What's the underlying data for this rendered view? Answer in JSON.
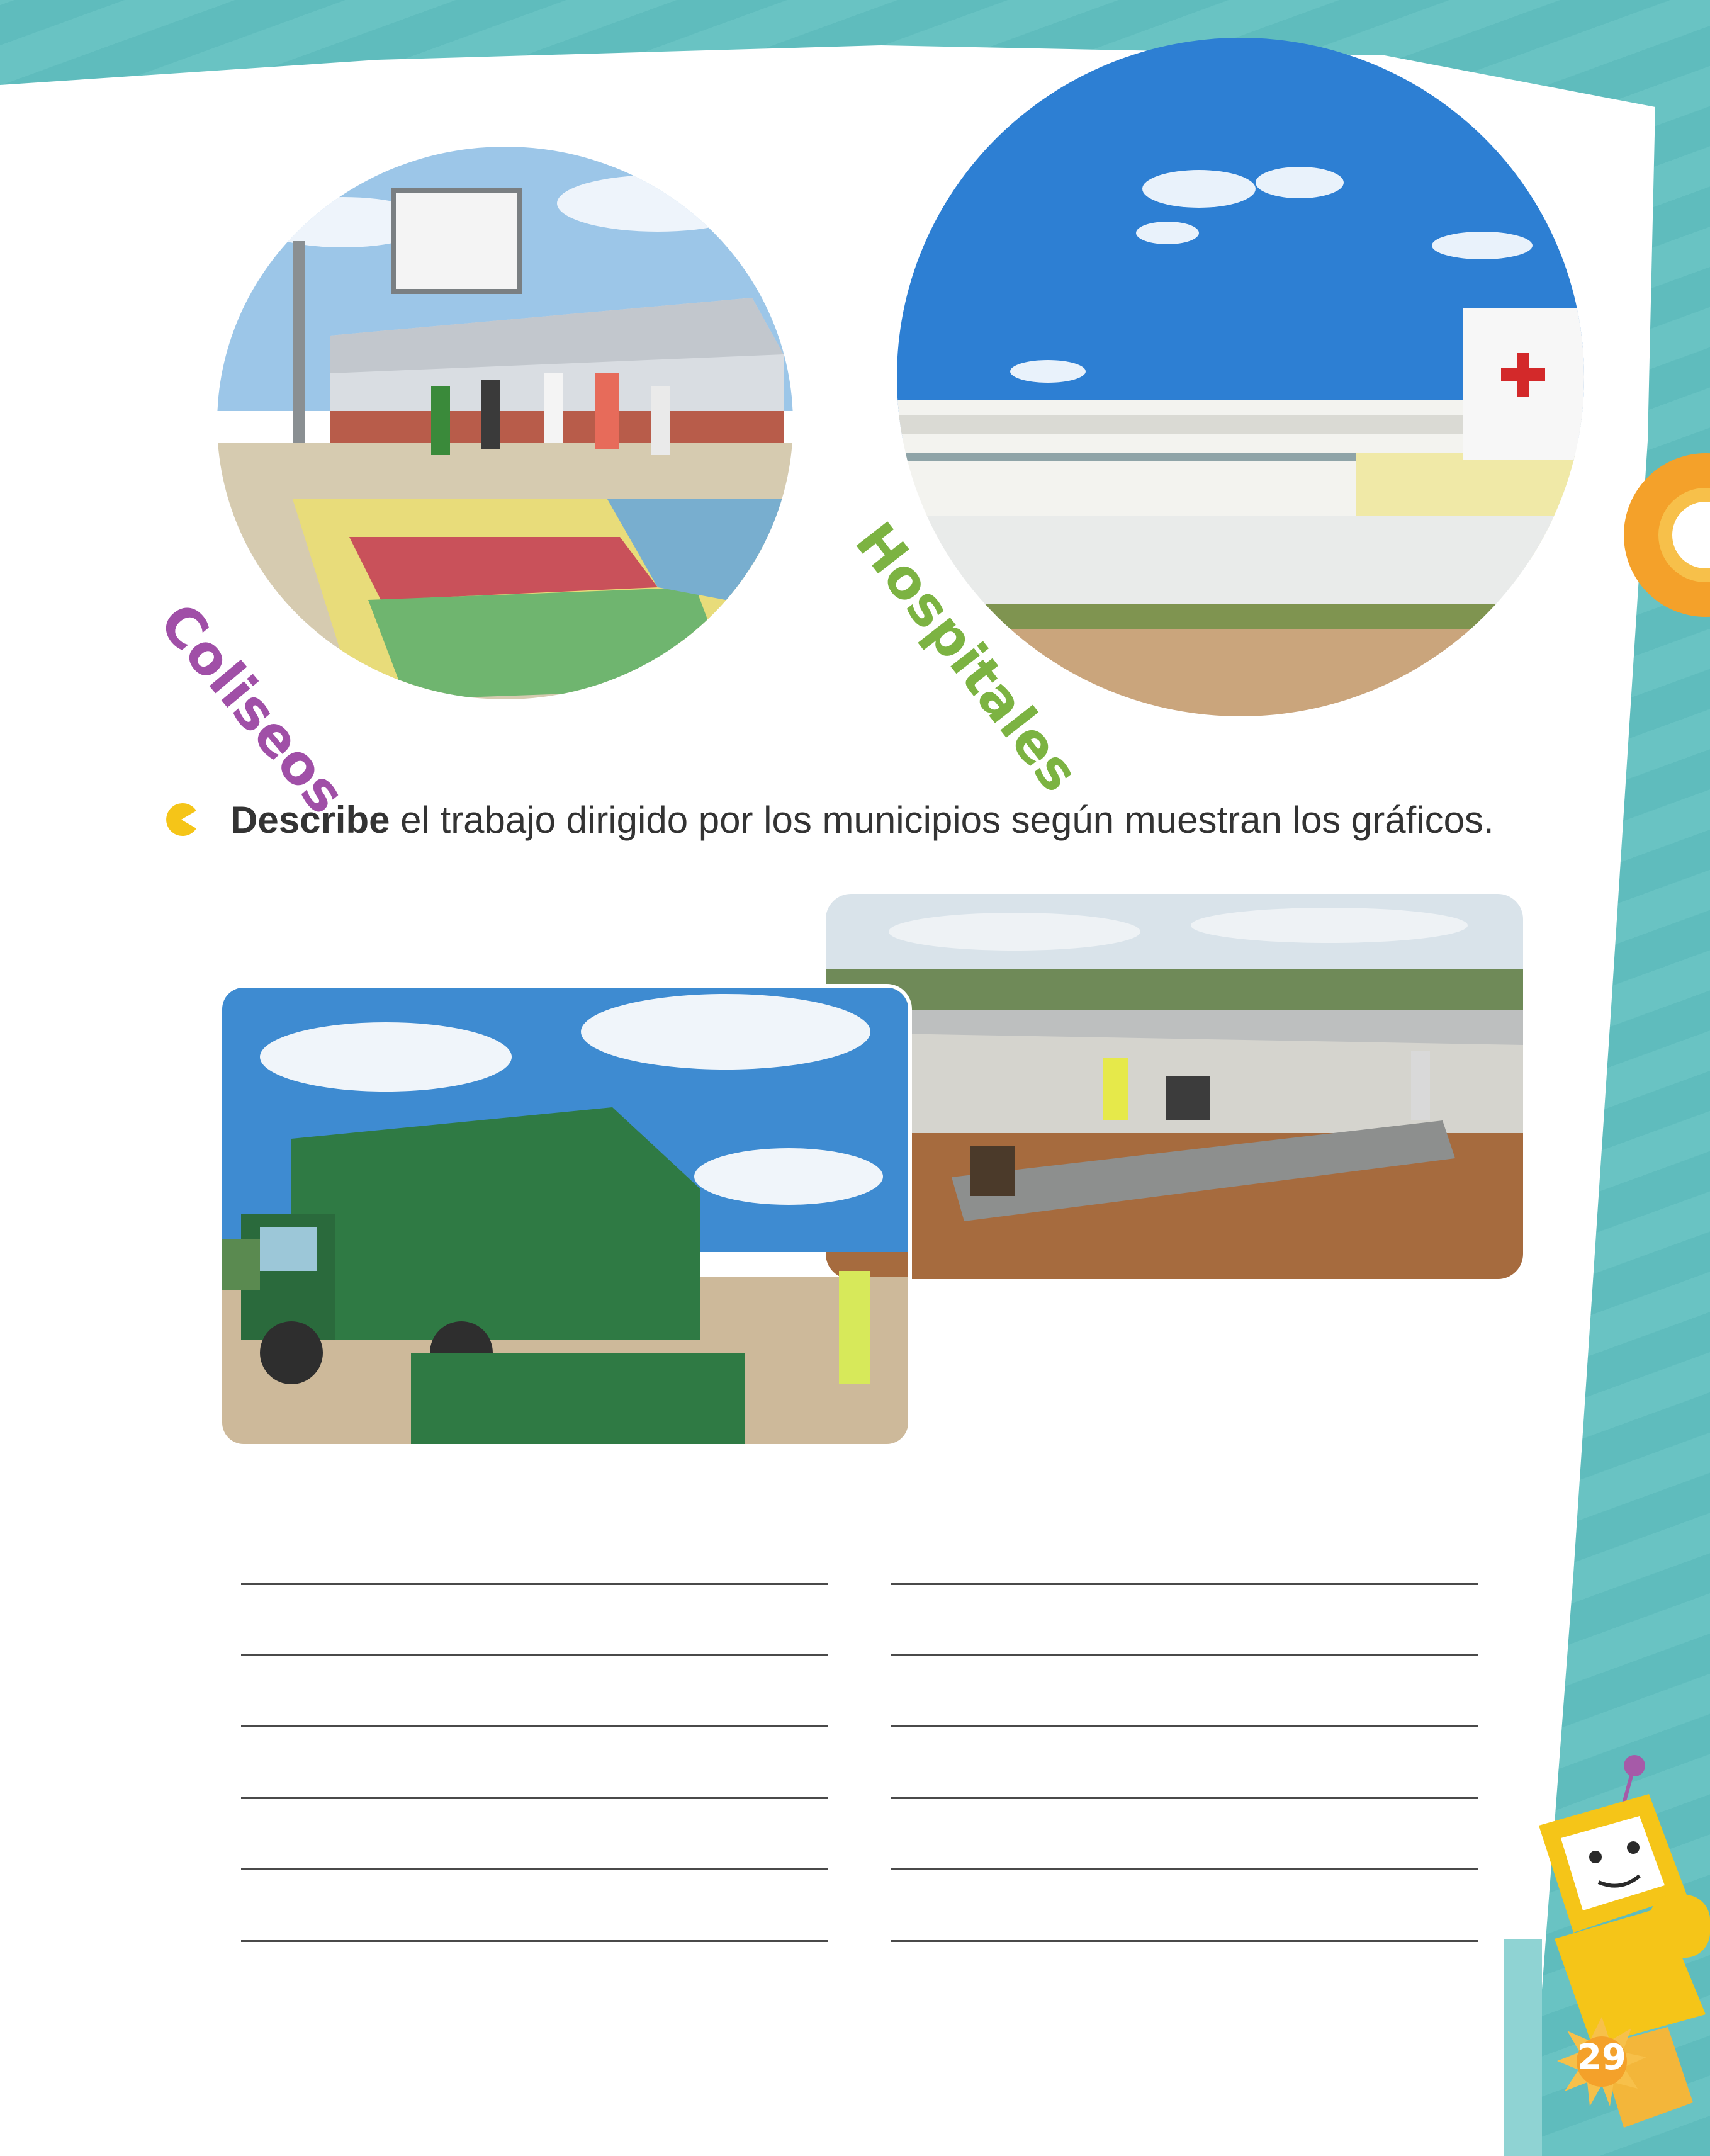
{
  "captions": {
    "coliseos": "Coliseos",
    "hospitales": "Hospitales"
  },
  "instruction": {
    "bold": "Describe",
    "rest": " el trabajo dirigido por los municipios según muestran los gráficos."
  },
  "page_number": "29",
  "colors": {
    "teal": "#5fbcbd",
    "purple_caption": "#a04fa7",
    "green_caption": "#7cb342",
    "accent_yellow": "#f5c518",
    "orange": "#f4a12a"
  },
  "photos": {
    "coliseo": "basketball-court-photo",
    "hospital": "hospital-building-photo",
    "garbage": "garbage-truck-photo",
    "construction": "road-construction-photo"
  },
  "writing_lines": 12
}
